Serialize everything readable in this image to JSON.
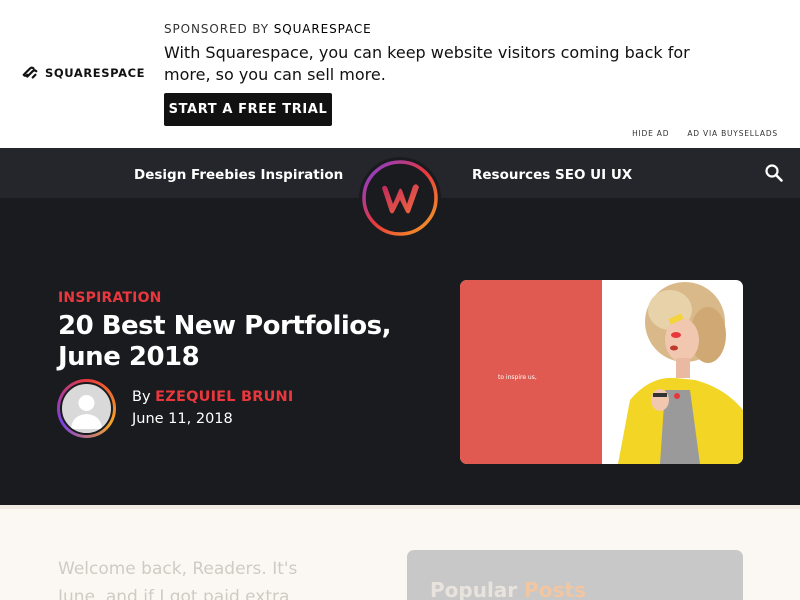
{
  "ad": {
    "brand": "SQUARESPACE",
    "sponsored_prefix": "SPONSORED BY ",
    "sponsored_brand": "SQUARESPACE",
    "copy": "With Squarespace, you can keep website visitors coming back for more, so you can sell more.",
    "cta_label": "START A FREE TRIAL",
    "hide_label": "HIDE AD",
    "via_label": "AD VIA BUYSELLADS"
  },
  "nav": {
    "left_label": "Design Freebies Inspiration",
    "right_label": "Resources SEO UI UX",
    "search_icon": "search-icon",
    "logo_letter": "W"
  },
  "hero": {
    "category": "INSPIRATION",
    "title": "20 Best New Portfolios, June 2018",
    "by_prefix": "By ",
    "author": "EZEQUIEL BRUNI",
    "date": "June 11, 2018",
    "image_tagline": "to inspire us,"
  },
  "content": {
    "intro": "Welcome back, Readers. It's June, and if I got paid extra",
    "popular_first": "Popular ",
    "popular_second": "Posts"
  },
  "colors": {
    "accent": "#e8383d",
    "nav_bg": "#25262b",
    "hero_bg": "#1a1b1f"
  }
}
